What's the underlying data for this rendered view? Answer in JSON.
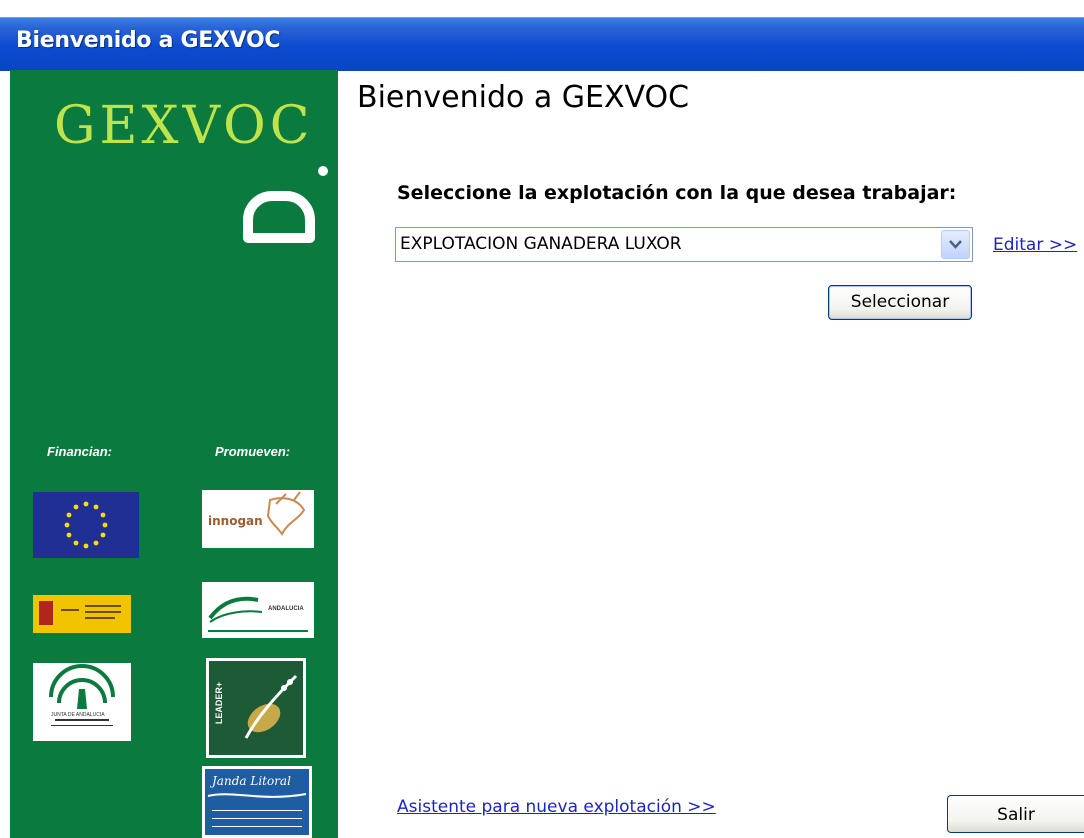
{
  "window": {
    "title": "Bienvenido a GEXVOC"
  },
  "sidebar": {
    "brand": "GEXVOC",
    "financian_label": "Financian:",
    "promueven_label": "Promueven:",
    "logos": {
      "innogan": "innogan",
      "andalucia": "ANDALUCIA",
      "junta": "JUNTA DE ANDALUCIA",
      "leader": "LEADER+",
      "janda": "Janda Litoral"
    }
  },
  "main": {
    "title": "Bienvenido a GEXVOC",
    "prompt": "Seleccione la explotación con la que desea trabajar:",
    "selected_explotacion": "EXPLOTACION GANADERA LUXOR",
    "edit_link": "Editar >>",
    "select_button": "Seleccionar",
    "wizard_link": "Asistente para nueva explotación >>",
    "exit_button": "Salir"
  },
  "colors": {
    "sidebar_bg": "#0b7a3f",
    "brand_text": "#bfe34a",
    "link": "#1c24c8",
    "titlebar": "#0a45c6"
  }
}
